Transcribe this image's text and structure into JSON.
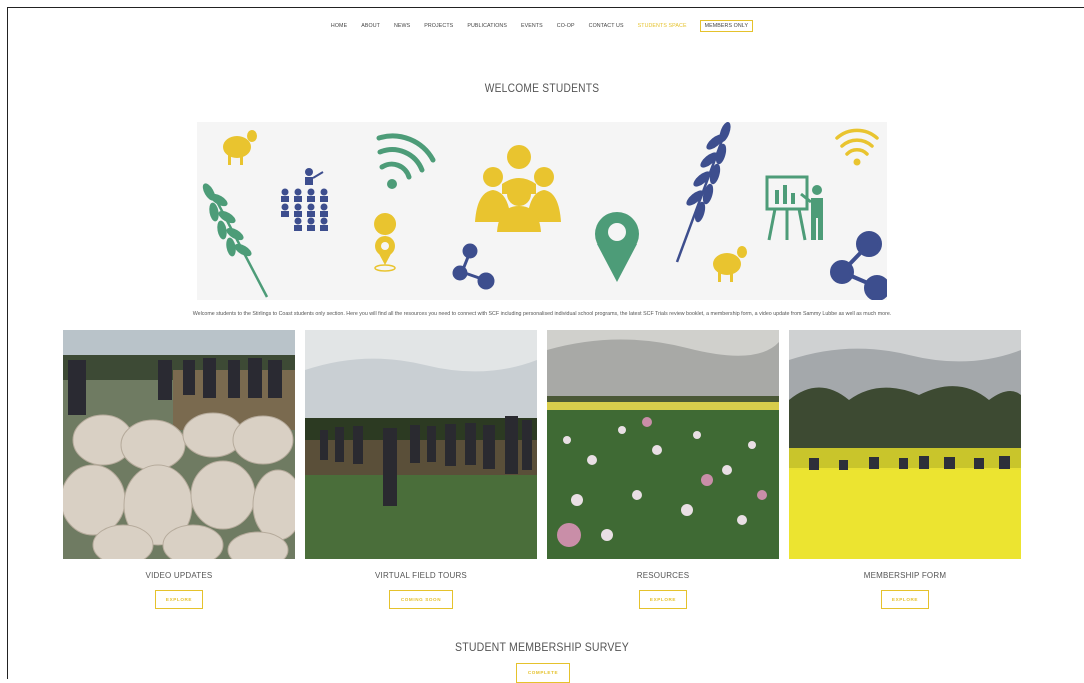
{
  "nav": {
    "items": [
      "HOME",
      "ABOUT",
      "NEWS",
      "PROJECTS",
      "PUBLICATIONS",
      "EVENTS",
      "CO-OP",
      "CONTACT US",
      "STUDENTS SPACE"
    ],
    "members_only": "MEMBERS ONLY",
    "active_color": "#e5c22c"
  },
  "page": {
    "title": "WELCOME STUDENTS",
    "intro": "Welcome students to the Stirlings to Coast students only section. Here you will find all the resources you need to connect with SCF including personalised individual school programs, the latest SCF Trials review booklet, a membership form, a video update from Sammy Lubbe as well as much more."
  },
  "banner": {
    "icons": [
      "sheep-icon",
      "wheat-icon",
      "classroom-icon",
      "wifi-icon",
      "location-pin-icon",
      "share-icon",
      "group-icon",
      "presenter-icon"
    ],
    "colors": {
      "yellow": "#e9c42f",
      "green": "#4d9c78",
      "navy": "#3d4e8e"
    }
  },
  "cards": [
    {
      "title": "VIDEO UPDATES",
      "button": "EXPLORE",
      "image": "sheep-pen-photo"
    },
    {
      "title": "VIRTUAL FIELD TOURS",
      "button": "COMING SOON",
      "image": "field-tour-photo"
    },
    {
      "title": "RESOURCES",
      "button": "EXPLORE",
      "image": "pea-crop-photo"
    },
    {
      "title": "MEMBERSHIP FORM",
      "button": "EXPLORE",
      "image": "canola-field-photo"
    }
  ],
  "survey": {
    "title": "STUDENT MEMBERSHIP SURVEY",
    "button": "COMPLETE"
  }
}
